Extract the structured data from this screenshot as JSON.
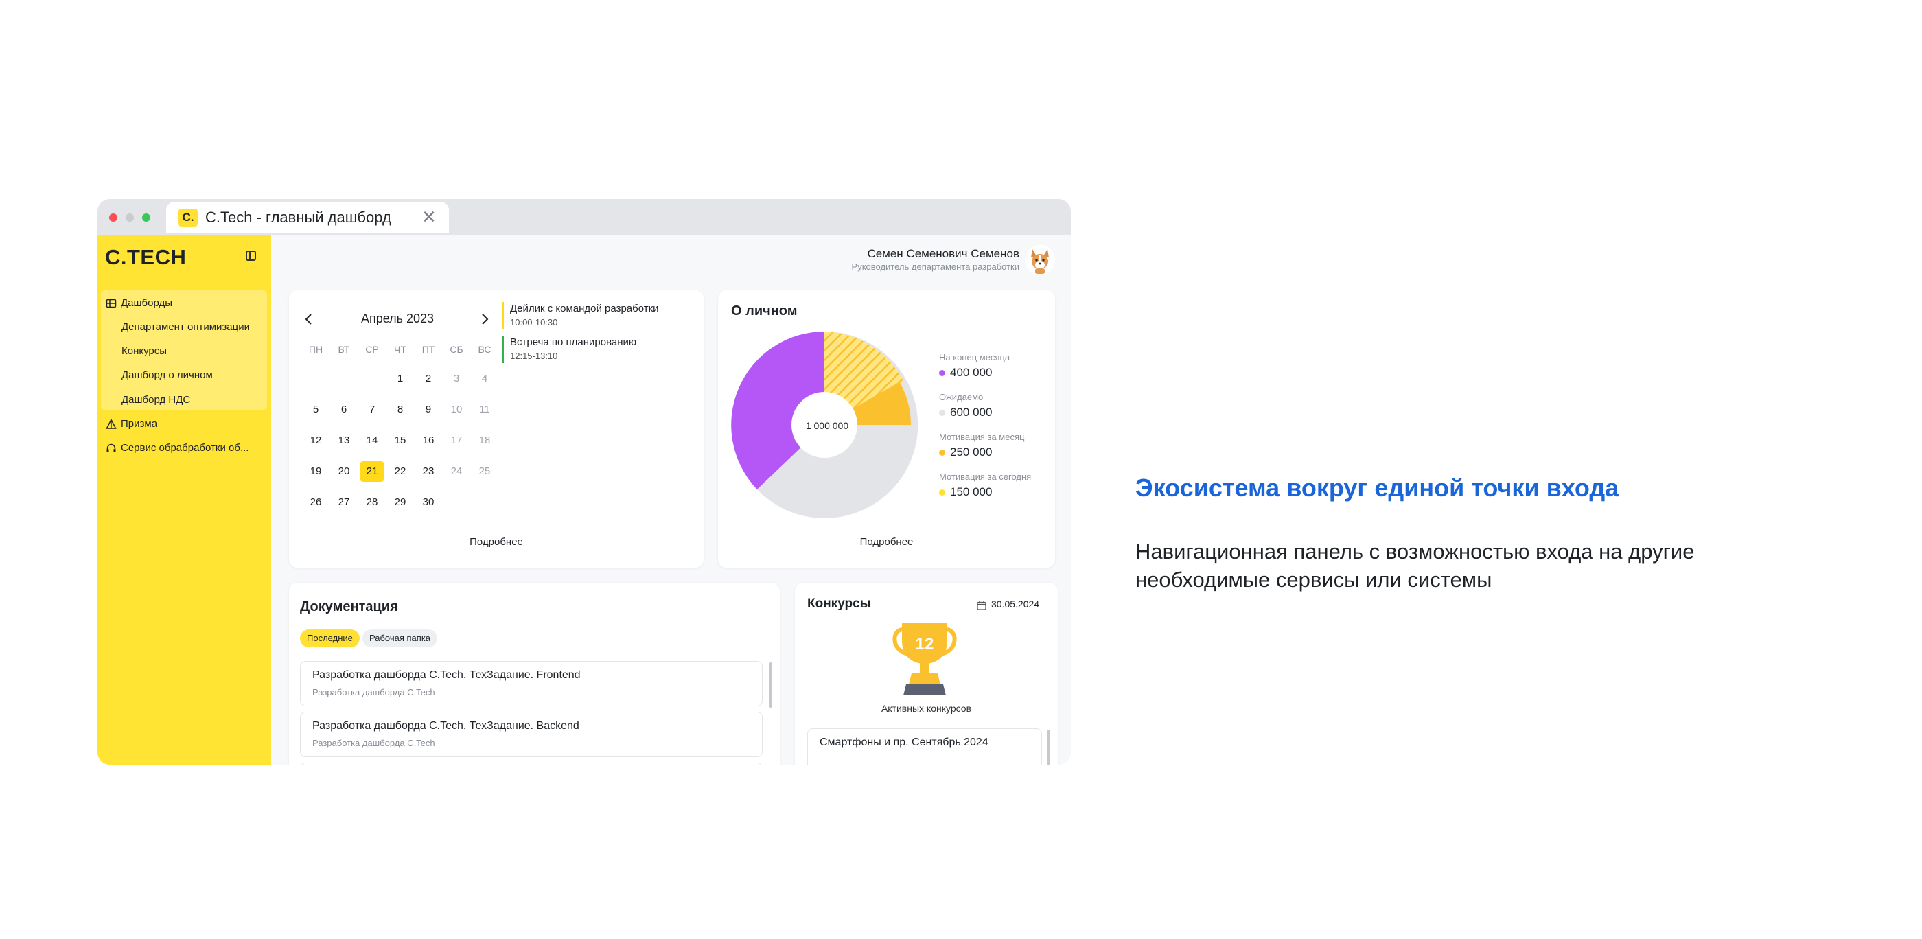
{
  "browser": {
    "tab_logo": "C.",
    "tab_title": "C.Tech - главный дашборд",
    "tab_close": "✕"
  },
  "sidebar": {
    "logo": "C.TECH",
    "items": [
      {
        "label": "Дашборды",
        "icon": "grid-icon"
      },
      {
        "label": "Департамент оптимизации"
      },
      {
        "label": "Конкурсы"
      },
      {
        "label": "Дашборд о личном"
      },
      {
        "label": "Дашборд НДС"
      },
      {
        "label": "Призма",
        "icon": "prism-icon"
      },
      {
        "label": "Сервис обрабработки об...",
        "icon": "headset-icon"
      }
    ]
  },
  "header": {
    "user_name": "Семен Семенович Семенов",
    "user_role": "Руководитель департамента разработки"
  },
  "calendar": {
    "month": "Апрель 2023",
    "weekdays": [
      "ПН",
      "ВТ",
      "СР",
      "ЧТ",
      "ПТ",
      "СБ",
      "ВС"
    ],
    "weeks": [
      [
        "",
        "",
        "",
        "1",
        "2",
        "3",
        "4"
      ],
      [
        "5",
        "6",
        "7",
        "8",
        "9",
        "10",
        "11"
      ],
      [
        "12",
        "13",
        "14",
        "15",
        "16",
        "17",
        "18"
      ],
      [
        "19",
        "20",
        "21",
        "22",
        "23",
        "24",
        "25"
      ],
      [
        "26",
        "27",
        "28",
        "29",
        "30",
        "",
        ""
      ]
    ],
    "selected": "21",
    "events": [
      {
        "title": "Дейлик с командой разработки",
        "time": "10:00-10:30",
        "color": "#ffd91a"
      },
      {
        "title": "Встреча по планированию",
        "time": "12:15-13:10",
        "color": "#2fb24a"
      }
    ],
    "more": "Подробнее"
  },
  "personal": {
    "title": "О личном",
    "center": "1 000 000",
    "legend": [
      {
        "caption": "На конец месяца",
        "value": "400 000",
        "color": "#b457f6"
      },
      {
        "caption": "Ожидаемо",
        "value": "600 000",
        "color": "#e3e4e8"
      },
      {
        "caption": "Мотивация за месяц",
        "value": "250 000",
        "color": "#fbc02d"
      },
      {
        "caption": "Мотивация за сегодня",
        "value": "150 000",
        "color": "#ffe033"
      }
    ],
    "more": "Подробнее"
  },
  "docs": {
    "title": "Документация",
    "chips": [
      "Последние",
      "Рабочая папка"
    ],
    "items": [
      {
        "title": "Разработка дашборда C.Tech. ТехЗадание. Frontend",
        "sub": "Разработка дашборда C.Tech"
      },
      {
        "title": "Разработка дашборда C.Tech. ТехЗадание. Backend",
        "sub": "Разработка дашборда C.Tech"
      }
    ]
  },
  "contests": {
    "title": "Конкурсы",
    "date": "30.05.2024",
    "count": "12",
    "caption": "Активных конкурсов",
    "items": [
      "Смартфоны и пр. Сентябрь 2024"
    ]
  },
  "promo": {
    "title": "Экосистема вокруг единой точки входа",
    "body": "Навигационная панель с возможностью входа на другие необходимые сервисы или системы"
  },
  "colors": {
    "accent_yellow": "#ffe433",
    "purple": "#b457f6",
    "blue_title": "#1a66d9"
  }
}
